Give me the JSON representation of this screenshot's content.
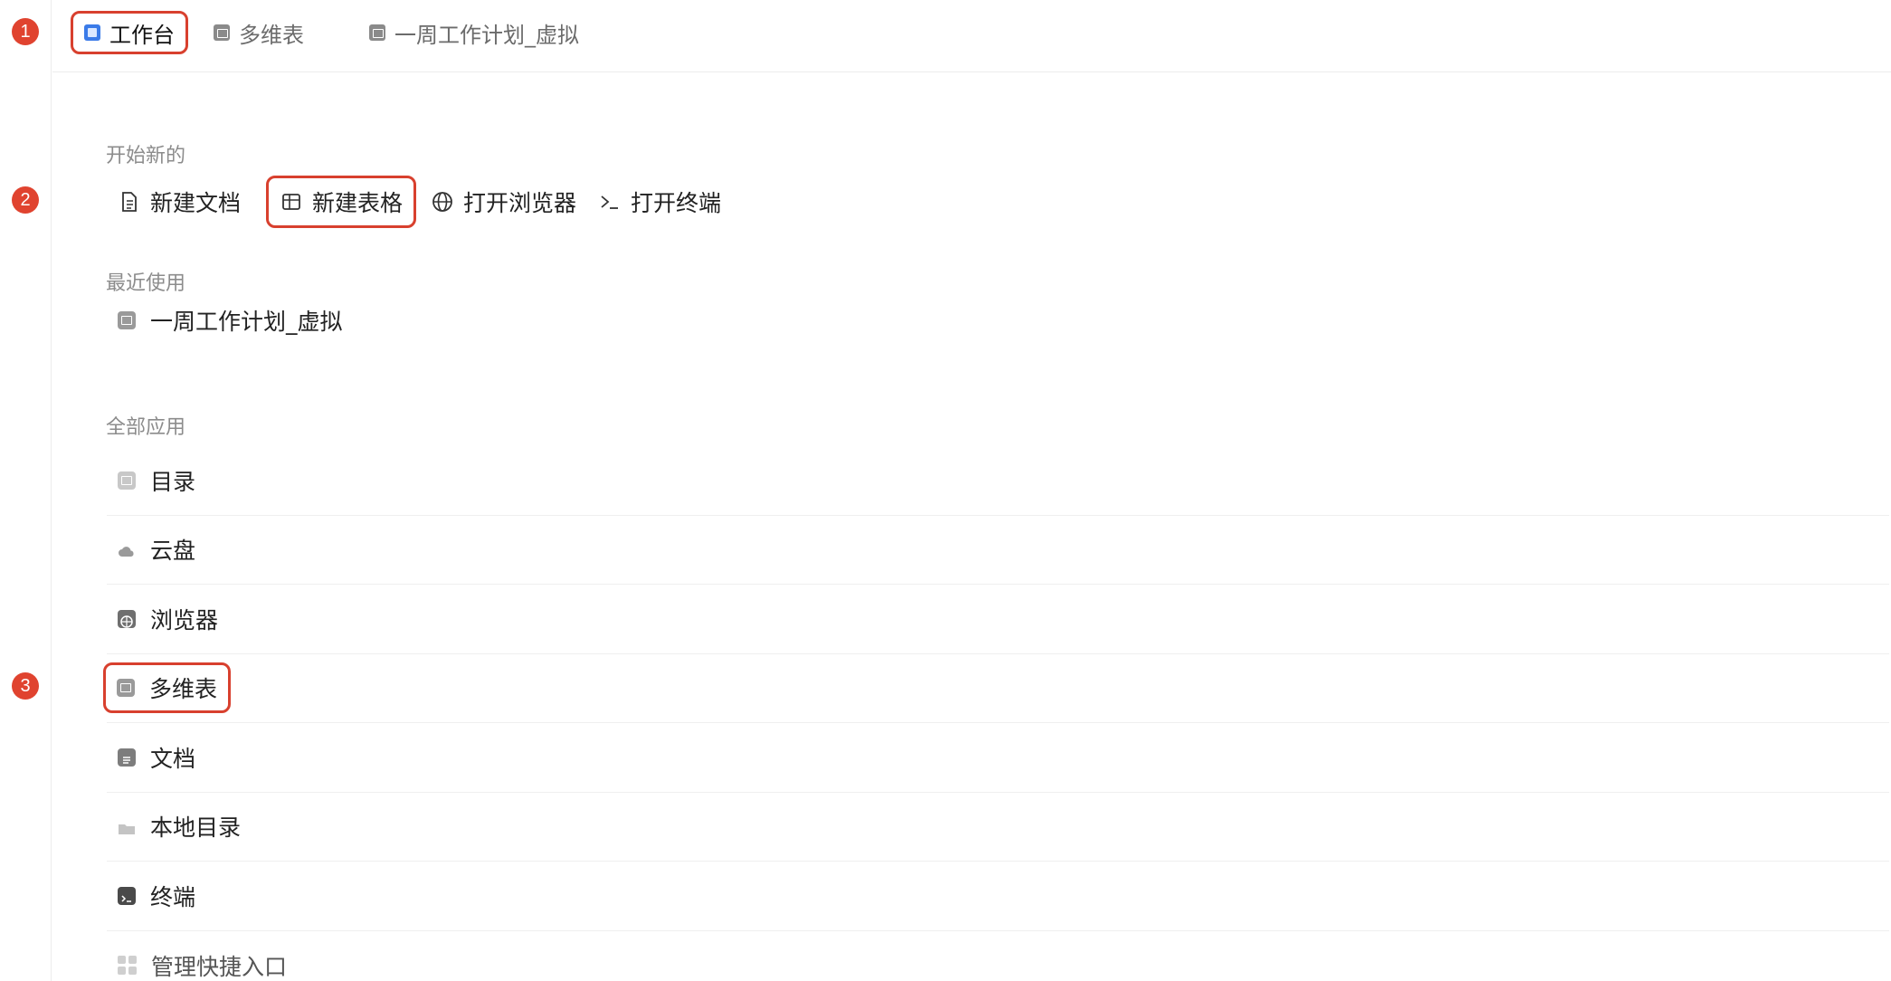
{
  "steps": [
    "1",
    "2",
    "3"
  ],
  "tabs": [
    {
      "label": "工作台",
      "icon": "workbench-icon"
    },
    {
      "label": "多维表",
      "icon": "table-icon"
    },
    {
      "label": "一周工作计划_虚拟",
      "icon": "table-icon"
    }
  ],
  "start_new": {
    "label": "开始新的",
    "actions": [
      {
        "label": "新建文档",
        "icon": "document-icon"
      },
      {
        "label": "新建表格",
        "icon": "table-icon"
      },
      {
        "label": "打开浏览器",
        "icon": "globe-icon"
      },
      {
        "label": "打开终端",
        "icon": "terminal-icon"
      }
    ]
  },
  "recent": {
    "label": "最近使用",
    "items": [
      {
        "label": "一周工作计划_虚拟",
        "icon": "table-icon"
      }
    ]
  },
  "all_apps": {
    "label": "全部应用",
    "items": [
      {
        "label": "目录",
        "icon": "directory-icon"
      },
      {
        "label": "云盘",
        "icon": "cloud-drive-icon"
      },
      {
        "label": "浏览器",
        "icon": "browser-icon"
      },
      {
        "label": "多维表",
        "icon": "table-icon"
      },
      {
        "label": "文档",
        "icon": "document-icon"
      },
      {
        "label": "本地目录",
        "icon": "folder-icon"
      },
      {
        "label": "终端",
        "icon": "terminal-icon"
      },
      {
        "label": "管理快捷入口",
        "icon": "grid-icon"
      }
    ]
  },
  "colors": {
    "highlight": "#d8402e",
    "step_badge": "#e0432f",
    "accent": "#3b7be8"
  }
}
